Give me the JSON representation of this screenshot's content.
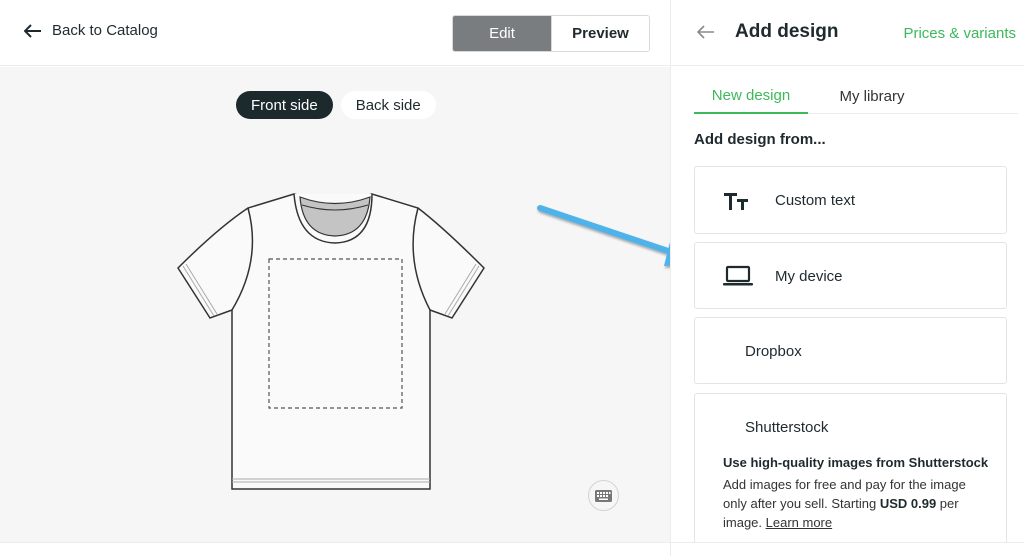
{
  "header": {
    "back_label": "Back to Catalog",
    "modes": [
      {
        "label": "Edit",
        "active": true
      },
      {
        "label": "Preview",
        "active": false
      }
    ]
  },
  "canvas": {
    "sides": [
      {
        "label": "Front side",
        "active": true
      },
      {
        "label": "Back side",
        "active": false
      }
    ],
    "product": "t-shirt",
    "keyboard_icon": "keyboard-icon",
    "annotation_arrow_color": "#4fb3ea"
  },
  "panel": {
    "title": "Add design",
    "back_icon": "arrow-left-icon",
    "prices_link": "Prices & variants",
    "tabs": [
      {
        "label": "New design",
        "active": true
      },
      {
        "label": "My library",
        "active": false
      }
    ],
    "section_heading": "Add design from...",
    "options": [
      {
        "label": "Custom text",
        "icon": "text-size-icon"
      },
      {
        "label": "My device",
        "icon": "laptop-icon"
      },
      {
        "label": "Dropbox",
        "icon": ""
      },
      {
        "label": "Shutterstock",
        "icon": ""
      }
    ],
    "shutterstock": {
      "title": "Use high-quality images from Shutterstock",
      "desc_pre": "Add images for free and pay for the image only after you sell. Starting ",
      "price": "USD 0.99",
      "desc_post": " per image. ",
      "learn_more": "Learn more"
    }
  },
  "colors": {
    "accent_green": "#3cb95b",
    "dark": "#1c2a2e",
    "edit_bg": "#7a7d7f"
  }
}
